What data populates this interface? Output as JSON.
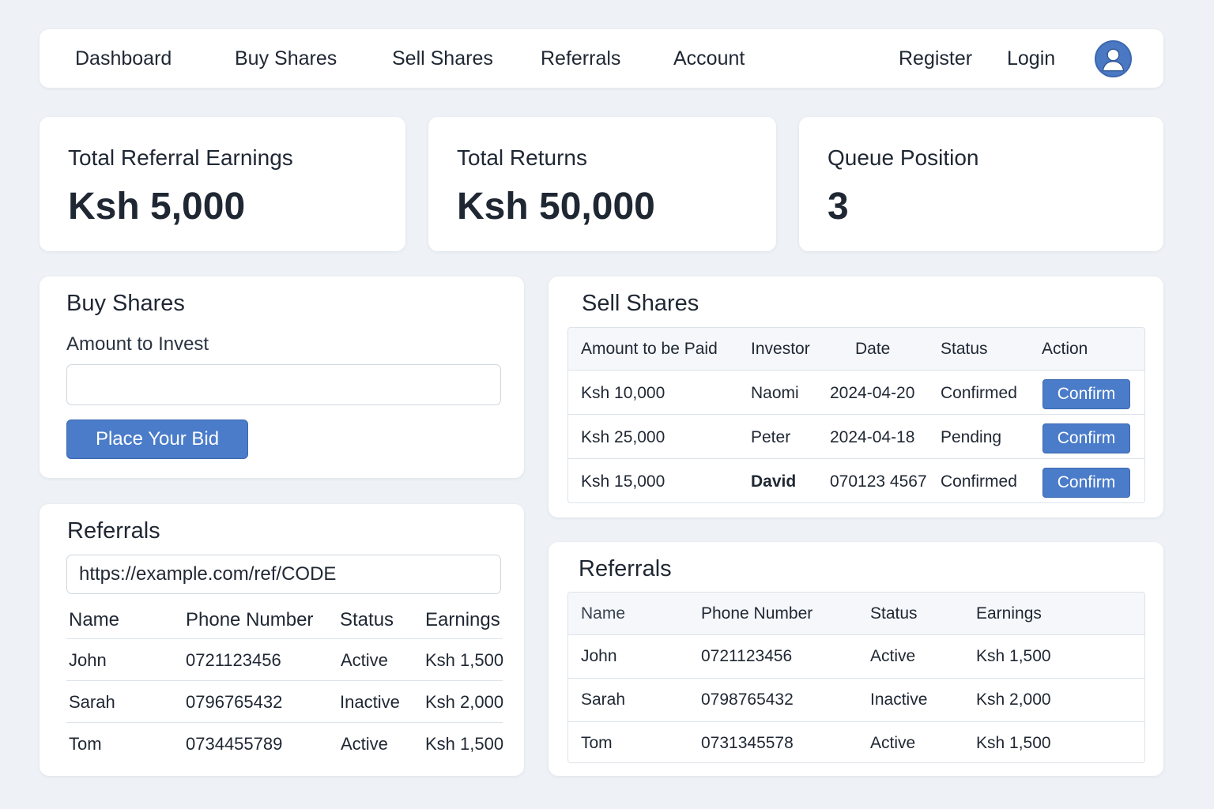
{
  "nav": {
    "dashboard": "Dashboard",
    "buy_shares": "Buy Shares",
    "sell_shares": "Sell Shares",
    "referrals": "Referrals",
    "account": "Account",
    "register": "Register",
    "login": "Login",
    "avatar_icon": "user-avatar-icon"
  },
  "stats": {
    "referral_earnings": {
      "label": "Total Referral Earnings",
      "value": "Ksh 5,000"
    },
    "total_returns": {
      "label": "Total Returns",
      "value": "Ksh 50,000"
    },
    "queue_position": {
      "label": "Queue Position",
      "value": "3"
    }
  },
  "buy": {
    "title": "Buy Shares",
    "amount_label": "Amount to Invest",
    "amount_value": "",
    "button": "Place Your Bid"
  },
  "sell": {
    "title": "Sell Shares",
    "headers": [
      "Amount to be Paid",
      "Investor",
      "Date",
      "Status",
      "Action"
    ],
    "rows": [
      {
        "amount": "Ksh 10,000",
        "investor": "Naomi",
        "date": "2024-04-20",
        "status": "Confirmed",
        "action": "Confirm"
      },
      {
        "amount": "Ksh 25,000",
        "investor": "Peter",
        "date": "2024-04-18",
        "status": "Pending",
        "action": "Confirm"
      },
      {
        "amount": "Ksh 15,000",
        "investor": "David",
        "date": "070123 4567",
        "status": "Confirmed",
        "action": "Confirm"
      }
    ]
  },
  "referrals_left": {
    "title": "Referrals",
    "link": "https://example.com/ref/CODE",
    "headers": [
      "Name",
      "Phone Number",
      "Status",
      "Earnings"
    ],
    "rows": [
      {
        "name": "John",
        "phone": "0721123456",
        "status": "Active",
        "earnings": "Ksh 1,500"
      },
      {
        "name": "Sarah",
        "phone": "0796765432",
        "status": "Inactive",
        "earnings": "Ksh 2,000"
      },
      {
        "name": "Tom",
        "phone": "0734455789",
        "status": "Active",
        "earnings": "Ksh 1,500"
      }
    ]
  },
  "referrals_right": {
    "title": "Referrals",
    "headers": [
      "Name",
      "Phone Number",
      "Status",
      "Earnings"
    ],
    "rows": [
      {
        "name": "John",
        "phone": "0721123456",
        "status": "Active",
        "earnings": "Ksh 1,500"
      },
      {
        "name": "Sarah",
        "phone": "0798765432",
        "status": "Inactive",
        "earnings": "Ksh 2,000"
      },
      {
        "name": "Tom",
        "phone": "0731345578",
        "status": "Active",
        "earnings": "Ksh 1,500"
      }
    ]
  },
  "colors": {
    "background": "#eef2f6",
    "primary_button": "#4a7cc9",
    "avatar": "#4a78c2",
    "text": "#1f2733"
  }
}
